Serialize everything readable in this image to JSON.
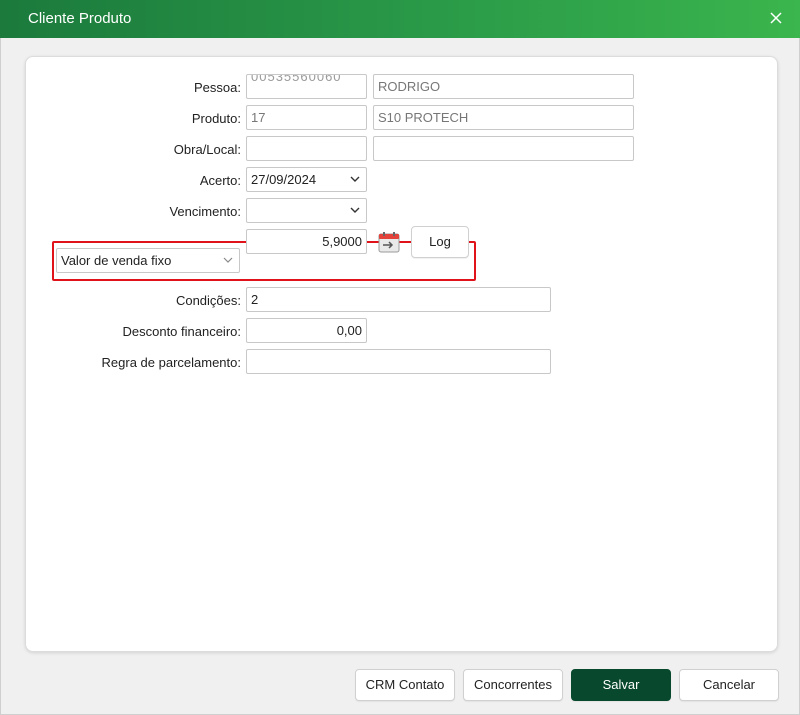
{
  "window": {
    "title": "Cliente Produto",
    "close_icon": "close-icon"
  },
  "form": {
    "pessoa": {
      "label": "Pessoa:",
      "code_value": "00535560060",
      "name_value": "RODRIGO"
    },
    "produto": {
      "label": "Produto:",
      "code_value": "17",
      "name_value": "S10 PROTECH"
    },
    "obra_local": {
      "label": "Obra/Local:",
      "code_value": "",
      "name_value": ""
    },
    "acerto": {
      "label": "Acerto:",
      "value": "27/09/2024"
    },
    "vencimento": {
      "label": "Vencimento:",
      "value": ""
    },
    "valor": {
      "type_selected": "Valor de venda fixo",
      "value": "5,9000",
      "log_label": "Log",
      "calendar_icon": "calendar-icon"
    },
    "condicoes": {
      "label": "Condições:",
      "value": "2"
    },
    "desconto": {
      "label": "Desconto financeiro:",
      "value": "0,00"
    },
    "regra": {
      "label": "Regra de parcelamento:",
      "value": ""
    }
  },
  "footer": {
    "crm_label": "CRM Contato",
    "concorrentes_label": "Concorrentes",
    "salvar_label": "Salvar",
    "cancelar_label": "Cancelar"
  },
  "colors": {
    "titlebar_start": "#1b7a3c",
    "titlebar_end": "#3bb54d",
    "primary_button": "#08492e",
    "highlight": "#e0131b"
  }
}
